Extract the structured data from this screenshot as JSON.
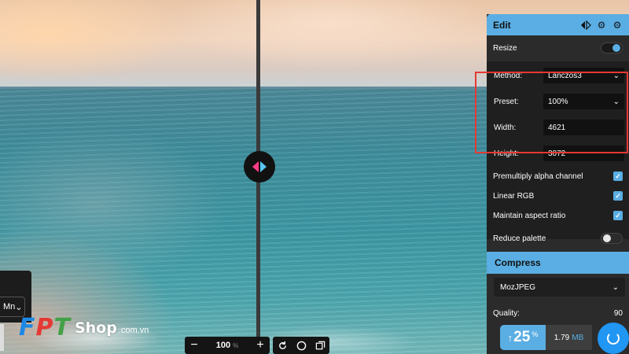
{
  "edit": {
    "title": "Edit",
    "icons": [
      "compare-icon",
      "settings-gear-icon",
      "reset-settings-icon"
    ],
    "resize_label": "Resize",
    "resize_on": true,
    "method_label": "Method:",
    "method_value": "Lanczos3",
    "preset_label": "Preset:",
    "preset_value": "100%",
    "width_label": "Width:",
    "width_value": "4621",
    "height_label": "Height:",
    "height_value": "3072",
    "premultiply_label": "Premultiply alpha channel",
    "premultiply_checked": true,
    "linear_rgb_label": "Linear RGB",
    "linear_rgb_checked": true,
    "aspect_label": "Maintain aspect ratio",
    "aspect_checked": true,
    "reduce_palette_label": "Reduce palette",
    "reduce_palette_on": false
  },
  "compress": {
    "title": "Compress",
    "codec": "MozJPEG",
    "quality_label": "Quality:",
    "quality_value": "90"
  },
  "zoom": {
    "minus": "−",
    "value": "100",
    "unit": "%",
    "plus": "+"
  },
  "stats": {
    "arrow": "↑",
    "percent": "25",
    "percent_unit": "%",
    "size_value": "1.79",
    "size_unit": "MB"
  },
  "left_panel": {
    "select_value": "Mn"
  },
  "logo": {
    "letters": [
      "F",
      "P",
      "T"
    ],
    "shop": "Shop",
    "domain": ".com.vn"
  },
  "colors": {
    "accent": "#5aaee3",
    "panel_bg": "#2b2b2b",
    "highlight": "#e53935",
    "logo_f": "#1e88e5",
    "logo_p": "#e53935",
    "logo_t": "#43a047"
  }
}
